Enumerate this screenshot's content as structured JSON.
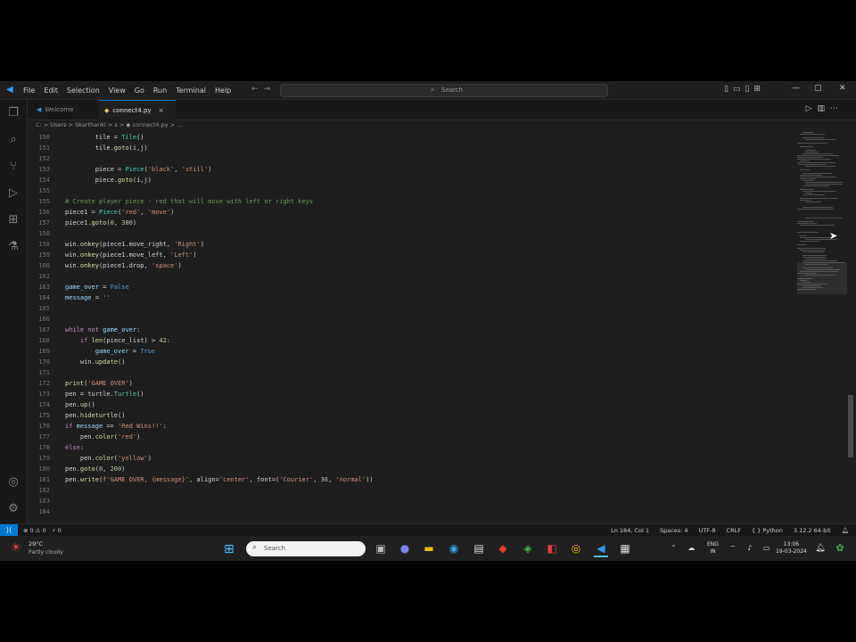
{
  "menu": [
    "File",
    "Edit",
    "Selection",
    "View",
    "Go",
    "Run",
    "Terminal",
    "Help"
  ],
  "search": {
    "placeholder": "Search"
  },
  "tabs": [
    {
      "label": "Welcome"
    },
    {
      "label": "connect4.py"
    }
  ],
  "breadcrumb": "C: > Users > Skarthanki > s > ◆ connect4.py > ...",
  "code_lines": [
    {
      "n": "150",
      "html": "        tile = <span class='cls'>Tile</span>()"
    },
    {
      "n": "151",
      "html": "        tile.<span class='fn'>goto</span>(i,j)"
    },
    {
      "n": "152",
      "html": ""
    },
    {
      "n": "153",
      "html": "        piece = <span class='cls'>Piece</span>(<span class='str'>'black'</span>, <span class='str'>'still'</span>)"
    },
    {
      "n": "154",
      "html": "        piece.<span class='fn'>goto</span>(i,j)"
    },
    {
      "n": "155",
      "html": ""
    },
    {
      "n": "155",
      "html": "<span class='cmt'># Create player piece - red that will move with left or right keys</span>"
    },
    {
      "n": "156",
      "html": "piece1 = <span class='cls'>Piece</span>(<span class='str'>'red'</span>, <span class='str'>'move'</span>)"
    },
    {
      "n": "157",
      "html": "piece1.<span class='fn'>goto</span>(<span class='num'>0</span>, <span class='num'>300</span>)"
    },
    {
      "n": "158",
      "html": ""
    },
    {
      "n": "158",
      "html": "win.<span class='fn'>onkey</span>(piece1.move_right, <span class='str'>'Right'</span>)"
    },
    {
      "n": "159",
      "html": "win.<span class='fn'>onkey</span>(piece1.move_left, <span class='str'>'Left'</span>)"
    },
    {
      "n": "160",
      "html": "win.<span class='fn'>onkey</span>(piece1.drop, <span class='str'>'space'</span>)"
    },
    {
      "n": "162",
      "html": ""
    },
    {
      "n": "163",
      "html": "<span class='var'>game_over</span> = <span class='bl'>False</span>"
    },
    {
      "n": "164",
      "html": "<span class='var'>message</span> = <span class='str'>''</span>"
    },
    {
      "n": "165",
      "html": ""
    },
    {
      "n": "166",
      "html": ""
    },
    {
      "n": "167",
      "html": "<span class='kw'>while not</span> <span class='var'>game_over</span>:"
    },
    {
      "n": "168",
      "html": "    <span class='kw'>if</span> <span class='fn'>len</span>(piece_list) &gt; <span class='num'>42</span>:"
    },
    {
      "n": "169",
      "html": "        <span class='var'>game_over</span> = <span class='bl'>True</span>"
    },
    {
      "n": "170",
      "html": "    win.<span class='fn'>update</span>()"
    },
    {
      "n": "171",
      "html": ""
    },
    {
      "n": "172",
      "html": "<span class='fn'>print</span>(<span class='str'>'GAME OVER'</span>)"
    },
    {
      "n": "173",
      "html": "pen = turtle.<span class='cls'>Turtle</span>()"
    },
    {
      "n": "174",
      "html": "pen.<span class='fn'>up</span>()"
    },
    {
      "n": "175",
      "html": "pen.<span class='fn'>hideturtle</span>()"
    },
    {
      "n": "176",
      "html": "<span class='kw'>if</span> <span class='var'>message</span> == <span class='str'>'Red Wins!!'</span>:"
    },
    {
      "n": "177",
      "html": "    pen.<span class='fn'>color</span>(<span class='str'>'red'</span>)"
    },
    {
      "n": "178",
      "html": "<span class='kw'>else</span>:"
    },
    {
      "n": "179",
      "html": "    pen.<span class='fn'>color</span>(<span class='str'>'yellow'</span>)"
    },
    {
      "n": "180",
      "html": "pen.<span class='fn'>goto</span>(<span class='num'>0</span>, <span class='num'>200</span>)"
    },
    {
      "n": "181",
      "html": "pen.<span class='fn'>write</span>(<span class='str'>f'GAME OVER, {message}'</span>, align=<span class='str'>'center'</span>, font=(<span class='str'>'Courier'</span>, <span class='num'>36</span>, <span class='str'>'normal'</span>))"
    },
    {
      "n": "182",
      "html": ""
    },
    {
      "n": "183",
      "html": ""
    },
    {
      "n": "184",
      "html": ""
    }
  ],
  "status": {
    "problems": "⊗ 0 ⚠ 0",
    "ports": "⚡ 0",
    "position": "Ln 184, Col 1",
    "spaces": "Spaces: 4",
    "encoding": "UTF-8",
    "eol": "CRLF",
    "language": "{ } Python",
    "interpreter": "3.12.2 64-bit"
  },
  "taskbar": {
    "weather_temp": "29°C",
    "weather_desc": "Partly cloudy",
    "search_placeholder": "Search",
    "lang_top": "ENG",
    "lang_bottom": "IN",
    "time": "13:06",
    "date": "19-03-2024"
  },
  "colors": {
    "accent": "#0078d4",
    "editor_bg": "#1e1e1e",
    "statusbar_left": "#0078d4"
  }
}
